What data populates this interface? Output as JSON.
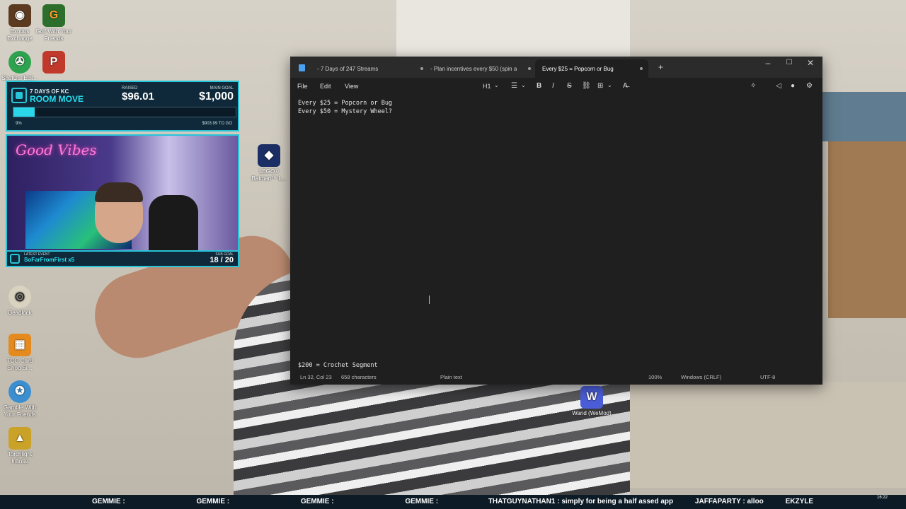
{
  "desktop": {
    "icons": [
      {
        "name": "Exodus Exchange",
        "label": "Exodus Exchange",
        "color": "#5b3a20",
        "glyph": "◉"
      },
      {
        "name": "Golf With Your Friends",
        "label": "Golf With Your Friends",
        "color": "#2c6e2c",
        "glyph": "G"
      },
      {
        "name": "Shotcut",
        "label": "ShotCut Edit...",
        "color": "#2ea34f",
        "glyph": "✇"
      },
      {
        "name": "Party Game",
        "label": "",
        "color": "#c0392b",
        "glyph": "P"
      },
      {
        "name": "LEGO Batman",
        "label": "LEGO® Batman™ L...",
        "color": "#1b2f66",
        "glyph": "◆"
      },
      {
        "name": "Deadlock",
        "label": "Deadlock",
        "color": "#d9d2c0",
        "glyph": "◎"
      },
      {
        "name": "TCG Card Shop Simulator",
        "label": "TCG Card Shop Si...",
        "color": "#e58a1f",
        "glyph": "▦"
      },
      {
        "name": "Gamble With Your Friends",
        "label": "Gamble With Your Friends",
        "color": "#3b8fd0",
        "glyph": "✪"
      },
      {
        "name": "Torchlight Infinite",
        "label": "Torchlight Infinite",
        "color": "#c9a227",
        "glyph": "▲"
      },
      {
        "name": "Wand WeMod",
        "label": "Wand (WeMod)",
        "color": "#4b5ed8",
        "glyph": "W"
      }
    ]
  },
  "goal_widget": {
    "kicker": "7 DAYS OF KC",
    "event": "ROOM MOVE",
    "raised_label": "RAISED",
    "raised": "$96.01",
    "goal_label": "MAIN GOAL",
    "goal": "$1,000",
    "progress": 0.096,
    "percent": "9%",
    "to_go": "$903.99 TO GO"
  },
  "cam": {
    "neon": "Good Vibes",
    "latest_label": "LATEST EVENT",
    "latest_event": "SoFarFromFirst x5",
    "sub_label": "SUB GOAL",
    "sub_count": "18 / 20"
  },
  "editor": {
    "tabs": [
      {
        "label": "- 7 Days of 247 Streams",
        "active": false
      },
      {
        "label": "- Plan incentives every $50 (spin a",
        "active": false
      },
      {
        "label": "Every $25 = Popcorn or Bug",
        "active": true
      }
    ],
    "menu": [
      "File",
      "Edit",
      "View"
    ],
    "toolbar": {
      "heading": "H1"
    },
    "lines": [
      "Every $25 = Popcorn or Bug",
      "Every $50 = Mystery Wheel?"
    ],
    "bottom_line": "$200 = Crochet Segment",
    "status": {
      "position": "Ln 32, Col 23",
      "chars": "658 characters",
      "mode": "Plain text",
      "zoom": "100%",
      "eol": "Windows (CRLF)",
      "encoding": "UTF-8"
    }
  },
  "taskbar": {
    "ticker": [
      "GEMMIE :",
      "GEMMIE :",
      "GEMMIE :",
      "GEMMIE :",
      "THATGUYNATHAN1 : simply for being a half assed app",
      "JAFFAPARTY : alloo",
      "EKZYLE"
    ],
    "clock": "16:22"
  }
}
